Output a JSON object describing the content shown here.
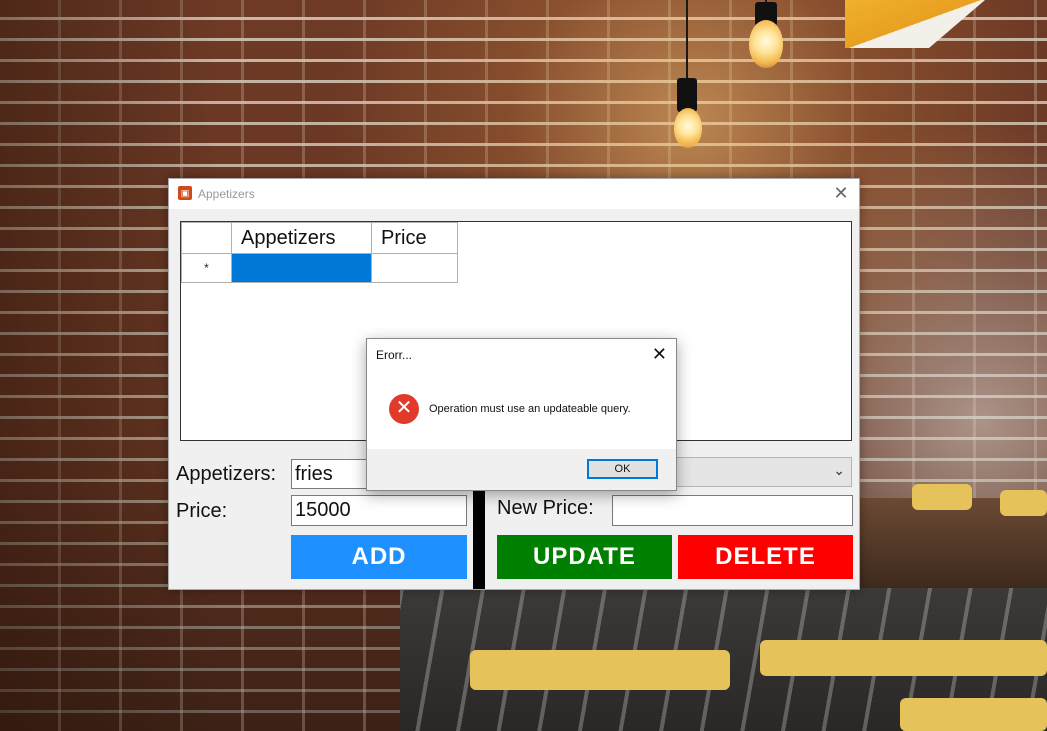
{
  "main_window": {
    "title": "Appetizers",
    "grid": {
      "columns": [
        "Appetizers",
        "Price"
      ],
      "new_row_marker": "*"
    },
    "form": {
      "appetizers_label": "Appetizers:",
      "appetizers_value": "fries",
      "price_label": "Price:",
      "price_value": "15000",
      "new_price_label": "New Price:",
      "new_price_value": ""
    },
    "buttons": {
      "add": "ADD",
      "update": "UPDATE",
      "delete": "DELETE"
    },
    "colors": {
      "add": "#1e90ff",
      "update": "#008000",
      "delete": "#ff0000",
      "selection": "#0078d7"
    }
  },
  "dialog": {
    "title": "Erorr...",
    "message": "Operation must use an updateable query.",
    "ok_label": "OK",
    "icon": "error-icon"
  }
}
